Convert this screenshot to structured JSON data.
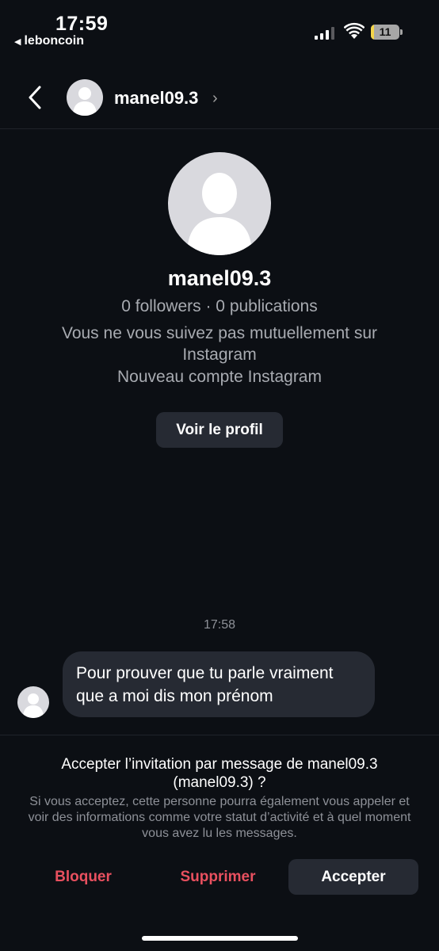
{
  "status_bar": {
    "time": "17:59",
    "back_app": "leboncoin",
    "battery_level": "11",
    "battery_fraction": 0.11
  },
  "header": {
    "username": "manel09.3"
  },
  "profile": {
    "username": "manel09.3",
    "stats": "0 followers · 0 publications",
    "mutual": "Vous ne vous suivez pas mutuellement sur Instagram",
    "new_account": "Nouveau compte Instagram",
    "view_profile_label": "Voir le profil"
  },
  "conversation": {
    "timestamp": "17:58",
    "message_text": "Pour prouver que tu parle vraiment que a moi dis mon prénom"
  },
  "invitation": {
    "title": "Accepter l’invitation par message de manel09.3 (manel09.3) ?",
    "description": "Si vous acceptez, cette personne pourra également vous appeler et voir des informations comme votre statut d’activité et à quel moment vous avez lu les messages.",
    "block_label": "Bloquer",
    "delete_label": "Supprimer",
    "accept_label": "Accepter"
  },
  "colors": {
    "background": "#0c0f14",
    "surface": "#262a33",
    "danger": "#e8505f",
    "muted_text": "#a8abb1"
  }
}
